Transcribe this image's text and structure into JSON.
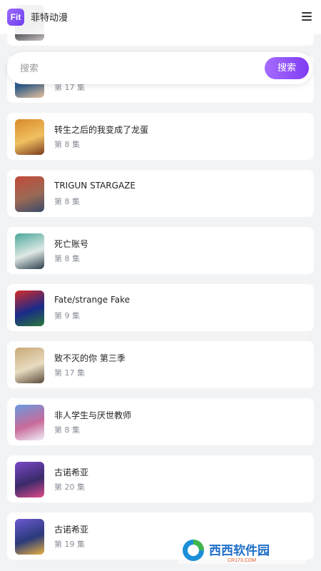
{
  "header": {
    "logo_text": "Fit",
    "title": "菲特动漫",
    "menu_icon": "hamburger-menu-icon"
  },
  "search": {
    "placeholder": "搜索",
    "button_label": "搜索"
  },
  "anime_list": [
    {
      "title": "",
      "episode": "",
      "thumb_colors": [
        "#6b6f7a",
        "#c9c2c0",
        "#3a3d48"
      ]
    },
    {
      "title": "",
      "episode": "第 17 集",
      "thumb_colors": [
        "#4a8fc8",
        "#e8c29a",
        "#2d5a8a"
      ]
    },
    {
      "title": "转生之后的我变成了龙蛋",
      "episode": "第 8 集",
      "thumb_colors": [
        "#d98a2b",
        "#7a3b1f",
        "#f0c060"
      ]
    },
    {
      "title": "TRIGUN STARGAZE",
      "episode": "第 8 集",
      "thumb_colors": [
        "#c44a3a",
        "#3b4a6a",
        "#9a6a55"
      ]
    },
    {
      "title": "死亡账号",
      "episode": "第 8 集",
      "thumb_colors": [
        "#4aa89a",
        "#2a3f4a",
        "#dfe8e5"
      ]
    },
    {
      "title": "Fate/strange Fake",
      "episode": "第 9 集",
      "thumb_colors": [
        "#d42b2b",
        "#2a7a3a",
        "#1a2a8a"
      ]
    },
    {
      "title": "致不灭的你 第三季",
      "episode": "第 17 集",
      "thumb_colors": [
        "#c9a878",
        "#5a4a3a",
        "#e8dcc0"
      ]
    },
    {
      "title": "非人学生与厌世教师",
      "episode": "第 8 集",
      "thumb_colors": [
        "#6a9ae0",
        "#f0f0f8",
        "#c86a9a"
      ]
    },
    {
      "title": "古诺希亚",
      "episode": "第 20 集",
      "thumb_colors": [
        "#7a4ac8",
        "#e04a8a",
        "#3a2a6a"
      ]
    },
    {
      "title": "古诺希亚",
      "episode": "第 19 集",
      "thumb_colors": [
        "#6a5ad0",
        "#e8b040",
        "#2a3a7a"
      ]
    }
  ],
  "watermark": {
    "text": "西西软件园",
    "url_text": "CR173.COM"
  }
}
